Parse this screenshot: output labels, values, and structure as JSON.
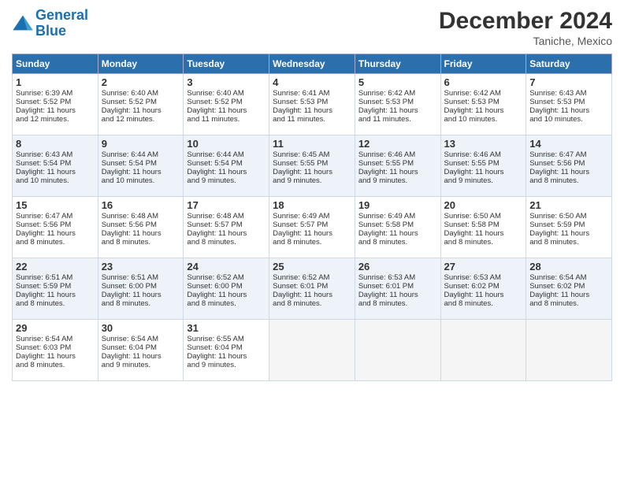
{
  "header": {
    "logo_line1": "General",
    "logo_line2": "Blue",
    "month": "December 2024",
    "location": "Taniche, Mexico"
  },
  "days_of_week": [
    "Sunday",
    "Monday",
    "Tuesday",
    "Wednesday",
    "Thursday",
    "Friday",
    "Saturday"
  ],
  "weeks": [
    [
      {
        "day": "1",
        "info": "Sunrise: 6:39 AM\nSunset: 5:52 PM\nDaylight: 11 hours\nand 12 minutes."
      },
      {
        "day": "2",
        "info": "Sunrise: 6:40 AM\nSunset: 5:52 PM\nDaylight: 11 hours\nand 12 minutes."
      },
      {
        "day": "3",
        "info": "Sunrise: 6:40 AM\nSunset: 5:52 PM\nDaylight: 11 hours\nand 11 minutes."
      },
      {
        "day": "4",
        "info": "Sunrise: 6:41 AM\nSunset: 5:53 PM\nDaylight: 11 hours\nand 11 minutes."
      },
      {
        "day": "5",
        "info": "Sunrise: 6:42 AM\nSunset: 5:53 PM\nDaylight: 11 hours\nand 11 minutes."
      },
      {
        "day": "6",
        "info": "Sunrise: 6:42 AM\nSunset: 5:53 PM\nDaylight: 11 hours\nand 10 minutes."
      },
      {
        "day": "7",
        "info": "Sunrise: 6:43 AM\nSunset: 5:53 PM\nDaylight: 11 hours\nand 10 minutes."
      }
    ],
    [
      {
        "day": "8",
        "info": "Sunrise: 6:43 AM\nSunset: 5:54 PM\nDaylight: 11 hours\nand 10 minutes."
      },
      {
        "day": "9",
        "info": "Sunrise: 6:44 AM\nSunset: 5:54 PM\nDaylight: 11 hours\nand 10 minutes."
      },
      {
        "day": "10",
        "info": "Sunrise: 6:44 AM\nSunset: 5:54 PM\nDaylight: 11 hours\nand 9 minutes."
      },
      {
        "day": "11",
        "info": "Sunrise: 6:45 AM\nSunset: 5:55 PM\nDaylight: 11 hours\nand 9 minutes."
      },
      {
        "day": "12",
        "info": "Sunrise: 6:46 AM\nSunset: 5:55 PM\nDaylight: 11 hours\nand 9 minutes."
      },
      {
        "day": "13",
        "info": "Sunrise: 6:46 AM\nSunset: 5:55 PM\nDaylight: 11 hours\nand 9 minutes."
      },
      {
        "day": "14",
        "info": "Sunrise: 6:47 AM\nSunset: 5:56 PM\nDaylight: 11 hours\nand 8 minutes."
      }
    ],
    [
      {
        "day": "15",
        "info": "Sunrise: 6:47 AM\nSunset: 5:56 PM\nDaylight: 11 hours\nand 8 minutes."
      },
      {
        "day": "16",
        "info": "Sunrise: 6:48 AM\nSunset: 5:56 PM\nDaylight: 11 hours\nand 8 minutes."
      },
      {
        "day": "17",
        "info": "Sunrise: 6:48 AM\nSunset: 5:57 PM\nDaylight: 11 hours\nand 8 minutes."
      },
      {
        "day": "18",
        "info": "Sunrise: 6:49 AM\nSunset: 5:57 PM\nDaylight: 11 hours\nand 8 minutes."
      },
      {
        "day": "19",
        "info": "Sunrise: 6:49 AM\nSunset: 5:58 PM\nDaylight: 11 hours\nand 8 minutes."
      },
      {
        "day": "20",
        "info": "Sunrise: 6:50 AM\nSunset: 5:58 PM\nDaylight: 11 hours\nand 8 minutes."
      },
      {
        "day": "21",
        "info": "Sunrise: 6:50 AM\nSunset: 5:59 PM\nDaylight: 11 hours\nand 8 minutes."
      }
    ],
    [
      {
        "day": "22",
        "info": "Sunrise: 6:51 AM\nSunset: 5:59 PM\nDaylight: 11 hours\nand 8 minutes."
      },
      {
        "day": "23",
        "info": "Sunrise: 6:51 AM\nSunset: 6:00 PM\nDaylight: 11 hours\nand 8 minutes."
      },
      {
        "day": "24",
        "info": "Sunrise: 6:52 AM\nSunset: 6:00 PM\nDaylight: 11 hours\nand 8 minutes."
      },
      {
        "day": "25",
        "info": "Sunrise: 6:52 AM\nSunset: 6:01 PM\nDaylight: 11 hours\nand 8 minutes."
      },
      {
        "day": "26",
        "info": "Sunrise: 6:53 AM\nSunset: 6:01 PM\nDaylight: 11 hours\nand 8 minutes."
      },
      {
        "day": "27",
        "info": "Sunrise: 6:53 AM\nSunset: 6:02 PM\nDaylight: 11 hours\nand 8 minutes."
      },
      {
        "day": "28",
        "info": "Sunrise: 6:54 AM\nSunset: 6:02 PM\nDaylight: 11 hours\nand 8 minutes."
      }
    ],
    [
      {
        "day": "29",
        "info": "Sunrise: 6:54 AM\nSunset: 6:03 PM\nDaylight: 11 hours\nand 8 minutes."
      },
      {
        "day": "30",
        "info": "Sunrise: 6:54 AM\nSunset: 6:04 PM\nDaylight: 11 hours\nand 9 minutes."
      },
      {
        "day": "31",
        "info": "Sunrise: 6:55 AM\nSunset: 6:04 PM\nDaylight: 11 hours\nand 9 minutes."
      },
      {
        "day": "",
        "info": ""
      },
      {
        "day": "",
        "info": ""
      },
      {
        "day": "",
        "info": ""
      },
      {
        "day": "",
        "info": ""
      }
    ]
  ]
}
